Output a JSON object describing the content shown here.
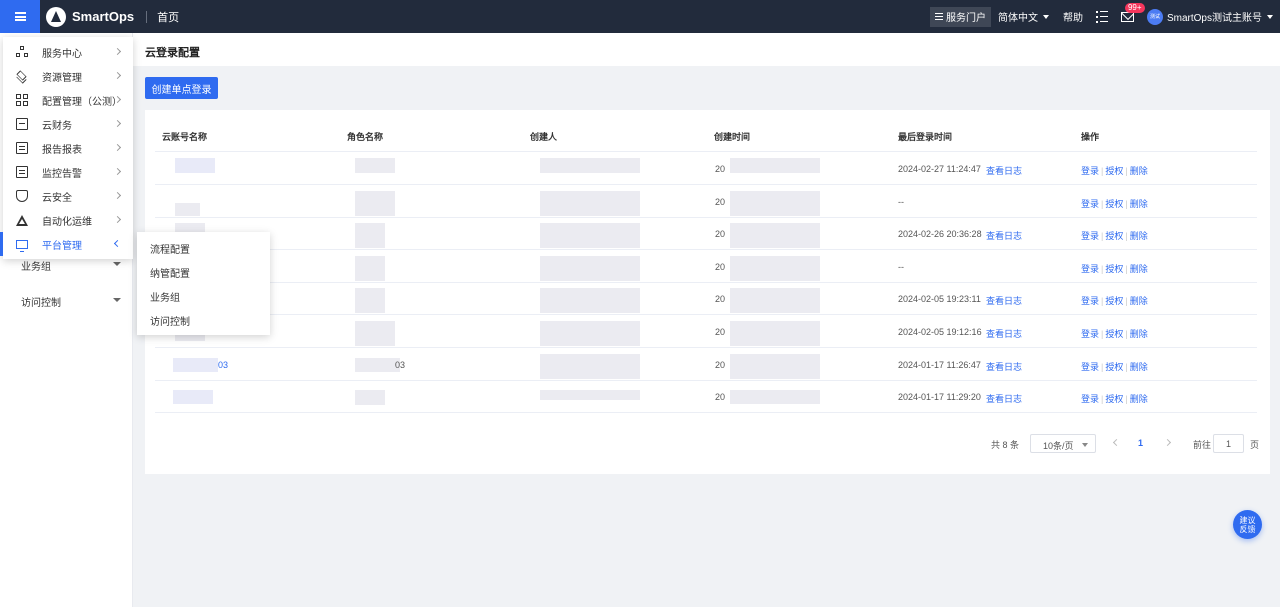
{
  "app": {
    "name": "SmartOps",
    "home": "首页"
  },
  "header": {
    "portal": "服务门户",
    "language": "简体中文",
    "help": "帮助",
    "notifications_badge": "99+",
    "avatar_text": "测试",
    "account": "SmartOps测试主账号"
  },
  "menu": {
    "items": [
      {
        "label": "服务中心",
        "icon": "network-icon"
      },
      {
        "label": "资源管理",
        "icon": "layers-icon"
      },
      {
        "label": "配置管理（公测）",
        "icon": "grid-icon"
      },
      {
        "label": "云财务",
        "icon": "finance-icon"
      },
      {
        "label": "报告报表",
        "icon": "report-icon"
      },
      {
        "label": "监控告警",
        "icon": "monitor-alert-icon"
      },
      {
        "label": "云安全",
        "icon": "shield-icon"
      },
      {
        "label": "自动化运维",
        "icon": "automation-icon"
      },
      {
        "label": "平台管理",
        "icon": "desktop-icon"
      }
    ],
    "platform_submenu": [
      "流程配置",
      "纳管配置",
      "业务组",
      "访问控制"
    ]
  },
  "sidebar": {
    "items": [
      "业务组",
      "访问控制"
    ]
  },
  "page": {
    "title": "云登录配置",
    "create_button": "创建单点登录"
  },
  "table": {
    "columns": [
      "云账号名称",
      "角色名称",
      "创建人",
      "创建时间",
      "最后登录时间",
      "操作"
    ],
    "rows": [
      {
        "account": "",
        "role": "",
        "creator": "",
        "created": "20",
        "last_login": "2024-02-27 11:24:47",
        "log_link": "查看日志"
      },
      {
        "account": "",
        "role": "",
        "creator": "",
        "created": "20",
        "last_login": "--",
        "log_link": ""
      },
      {
        "account": "",
        "role": "",
        "creator": "",
        "created": "20",
        "last_login": "2024-02-26 20:36:28",
        "log_link": "查看日志"
      },
      {
        "account": "",
        "role": "",
        "creator": "",
        "created": "20",
        "last_login": "--",
        "log_link": ""
      },
      {
        "account": "",
        "role": "",
        "creator": "",
        "created": "20",
        "last_login": "2024-02-05 19:23:11",
        "log_link": "查看日志"
      },
      {
        "account": "",
        "role": "",
        "creator": "",
        "created": "20",
        "last_login": "2024-02-05 19:12:16",
        "log_link": "查看日志"
      },
      {
        "account": "03",
        "role": "03",
        "creator": "",
        "created": "20",
        "last_login": "2024-01-17 11:26:47",
        "log_link": "查看日志"
      },
      {
        "account": "",
        "role": "",
        "creator": "",
        "created": "20",
        "last_login": "2024-01-17 11:29:20",
        "log_link": "查看日志"
      }
    ],
    "actions": [
      "登录",
      "授权",
      "删除"
    ]
  },
  "pagination": {
    "total": "共 8 条",
    "page_size": "10条/页",
    "current": "1",
    "goto_label": "前往",
    "goto_value": "1",
    "page_unit": "页"
  },
  "feedback": {
    "line1": "建议",
    "line2": "反馈"
  },
  "colors": {
    "primary": "#2f6bf0",
    "topbar": "#222b3c",
    "badge": "#f5365c"
  }
}
